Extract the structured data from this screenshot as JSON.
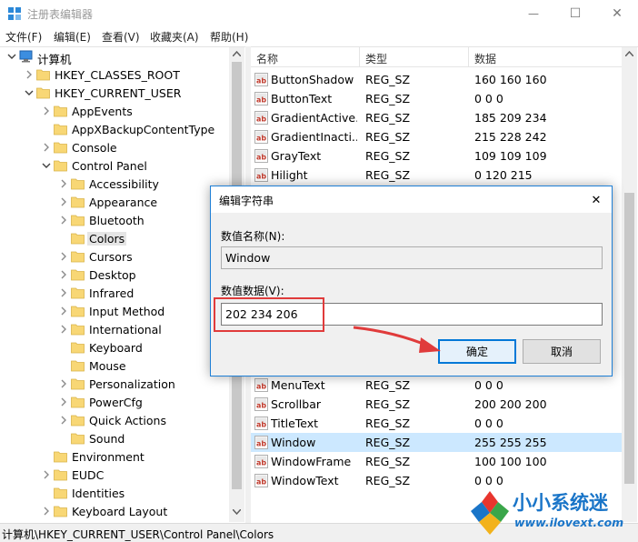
{
  "window": {
    "title": "注册表编辑器",
    "minimize_glyph": "—",
    "maximize_glyph": "☐",
    "close_glyph": "✕"
  },
  "menu": [
    "文件(F)",
    "编辑(E)",
    "查看(V)",
    "收藏夹(A)",
    "帮助(H)"
  ],
  "tree": [
    {
      "label": "计算机",
      "level": 0,
      "expanded": true,
      "icon": "computer-icon"
    },
    {
      "label": "HKEY_CLASSES_ROOT",
      "level": 1,
      "expanded": false
    },
    {
      "label": "HKEY_CURRENT_USER",
      "level": 1,
      "expanded": true
    },
    {
      "label": "AppEvents",
      "level": 2,
      "expanded": false
    },
    {
      "label": "AppXBackupContentType",
      "level": 2,
      "expanded": null
    },
    {
      "label": "Console",
      "level": 2,
      "expanded": false
    },
    {
      "label": "Control Panel",
      "level": 2,
      "expanded": true
    },
    {
      "label": "Accessibility",
      "level": 3,
      "expanded": false
    },
    {
      "label": "Appearance",
      "level": 3,
      "expanded": false
    },
    {
      "label": "Bluetooth",
      "level": 3,
      "expanded": false
    },
    {
      "label": "Colors",
      "level": 3,
      "expanded": null,
      "selected": true
    },
    {
      "label": "Cursors",
      "level": 3,
      "expanded": false
    },
    {
      "label": "Desktop",
      "level": 3,
      "expanded": false
    },
    {
      "label": "Infrared",
      "level": 3,
      "expanded": false
    },
    {
      "label": "Input Method",
      "level": 3,
      "expanded": false
    },
    {
      "label": "International",
      "level": 3,
      "expanded": false
    },
    {
      "label": "Keyboard",
      "level": 3,
      "expanded": null
    },
    {
      "label": "Mouse",
      "level": 3,
      "expanded": null
    },
    {
      "label": "Personalization",
      "level": 3,
      "expanded": false
    },
    {
      "label": "PowerCfg",
      "level": 3,
      "expanded": false
    },
    {
      "label": "Quick Actions",
      "level": 3,
      "expanded": false
    },
    {
      "label": "Sound",
      "level": 3,
      "expanded": null
    },
    {
      "label": "Environment",
      "level": 2,
      "expanded": null
    },
    {
      "label": "EUDC",
      "level": 2,
      "expanded": false
    },
    {
      "label": "Identities",
      "level": 2,
      "expanded": null
    },
    {
      "label": "Keyboard Layout",
      "level": 2,
      "expanded": false
    }
  ],
  "list": {
    "headers": [
      "名称",
      "类型",
      "数据"
    ],
    "rows_top": [
      {
        "name": "ButtonShadow",
        "type": "REG_SZ",
        "data": "160 160 160"
      },
      {
        "name": "ButtonText",
        "type": "REG_SZ",
        "data": "0 0 0"
      },
      {
        "name": "GradientActive...",
        "type": "REG_SZ",
        "data": "185 209 234"
      },
      {
        "name": "GradientInacti...",
        "type": "REG_SZ",
        "data": "215 228 242"
      },
      {
        "name": "GrayText",
        "type": "REG_SZ",
        "data": "109 109 109"
      },
      {
        "name": "Hilight",
        "type": "REG_SZ",
        "data": "0 120 215"
      }
    ],
    "rows_bottom": [
      {
        "name": "MenuText",
        "type": "REG_SZ",
        "data": "0 0 0"
      },
      {
        "name": "Scrollbar",
        "type": "REG_SZ",
        "data": "200 200 200"
      },
      {
        "name": "TitleText",
        "type": "REG_SZ",
        "data": "0 0 0"
      },
      {
        "name": "Window",
        "type": "REG_SZ",
        "data": "255 255 255",
        "selected": true
      },
      {
        "name": "WindowFrame",
        "type": "REG_SZ",
        "data": "100 100 100"
      },
      {
        "name": "WindowText",
        "type": "REG_SZ",
        "data": "0 0 0"
      }
    ]
  },
  "dialog": {
    "title": "编辑字符串",
    "name_label": "数值名称(N):",
    "name_value": "Window",
    "data_label": "数值数据(V):",
    "data_value": "202 234 206",
    "ok_label": "确定",
    "cancel_label": "取消",
    "close_glyph": "✕"
  },
  "status": {
    "path": "计算机\\HKEY_CURRENT_USER\\Control Panel\\Colors"
  },
  "watermark": {
    "brand": "小小系统迷",
    "url": "www.ilovext.com"
  },
  "colors": {
    "accent": "#0078d7",
    "folder": "#f8d775",
    "annotation_red": "#e03b3b",
    "selection": "#cce8ff"
  }
}
